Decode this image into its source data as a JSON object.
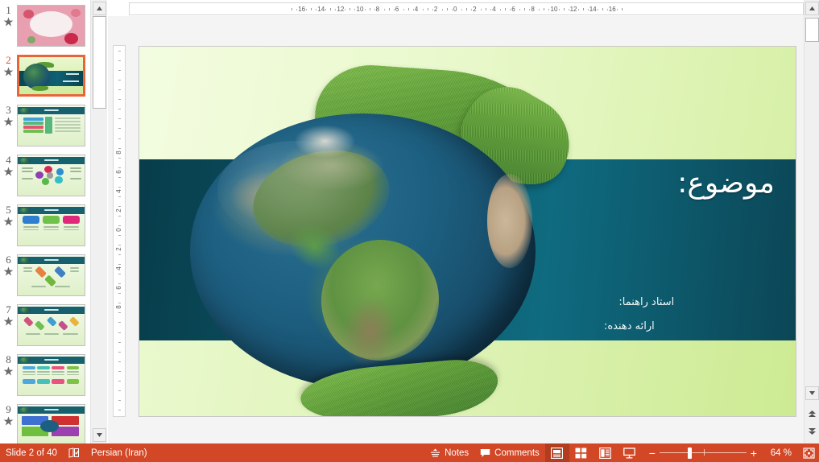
{
  "app": {
    "name": "PowerPoint Normal View"
  },
  "thumbnails": {
    "items": [
      {
        "number": "1",
        "kind": "pink-floral",
        "has_animation": true
      },
      {
        "number": "2",
        "kind": "globe-title",
        "has_animation": true,
        "selected": true
      },
      {
        "number": "3",
        "kind": "standard-list",
        "has_animation": true
      },
      {
        "number": "4",
        "kind": "standard-circles",
        "has_animation": true
      },
      {
        "number": "5",
        "kind": "standard-bubbles",
        "has_animation": true
      },
      {
        "number": "6",
        "kind": "standard-diamonds",
        "has_animation": true
      },
      {
        "number": "7",
        "kind": "standard-chevrons",
        "has_animation": true
      },
      {
        "number": "8",
        "kind": "standard-cards",
        "has_animation": true
      },
      {
        "number": "9",
        "kind": "standard-quadrant",
        "has_animation": true
      }
    ],
    "animation_icon": "star-icon"
  },
  "rulers": {
    "horizontal_ticks": [
      "16",
      "14",
      "12",
      "10",
      "8",
      "6",
      "4",
      "2",
      "0",
      "2",
      "4",
      "6",
      "8",
      "10",
      "12",
      "14",
      "16"
    ],
    "vertical_ticks": [
      "8",
      "6",
      "4",
      "2",
      "0",
      "2",
      "4",
      "6",
      "8"
    ],
    "units": "cm"
  },
  "slide": {
    "title": "موضوع:",
    "subtitle_1": "استاد راهنما:",
    "subtitle_2": "ارائه دهنده:",
    "image_name": "globe-in-grass-hands",
    "colors": {
      "band_dark_teal": "#0c5566",
      "background_light_green": "#eaf9cd",
      "background_mid_green": "#cdeb93",
      "title_text": "#ffffff"
    }
  },
  "statusbar": {
    "slide_count": "Slide 2 of 40",
    "language": "Persian (Iran)",
    "notes_label": "Notes",
    "comments_label": "Comments",
    "zoom_percent": "64 %",
    "zoom_minus": "−",
    "zoom_plus": "+",
    "accent_color": "#d24726",
    "active_view_color": "#b23c1e",
    "views": [
      {
        "name": "normal-view",
        "active": true
      },
      {
        "name": "slide-sorter-view",
        "active": false
      },
      {
        "name": "reading-view",
        "active": false
      },
      {
        "name": "slide-show-view",
        "active": false
      }
    ],
    "fit_button_name": "fit-slide-to-window-button"
  },
  "scrollbars": {
    "thumbnail_pane": {
      "up": "scroll-up-arrow",
      "down": "scroll-down-arrow"
    },
    "slide_pane": {
      "up": "scroll-up-arrow",
      "down": "scroll-down-arrow",
      "previous_slide": "previous-slide-button",
      "next_slide": "next-slide-button"
    }
  }
}
